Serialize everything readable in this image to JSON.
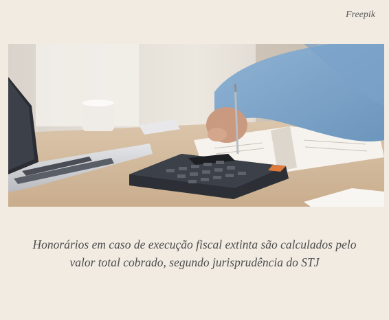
{
  "figure": {
    "credit": "Freepik",
    "caption": "Honorários em caso de execução fiscal extinta são calculados pelo valor total cobrado, segundo jurisprudência do STJ"
  }
}
